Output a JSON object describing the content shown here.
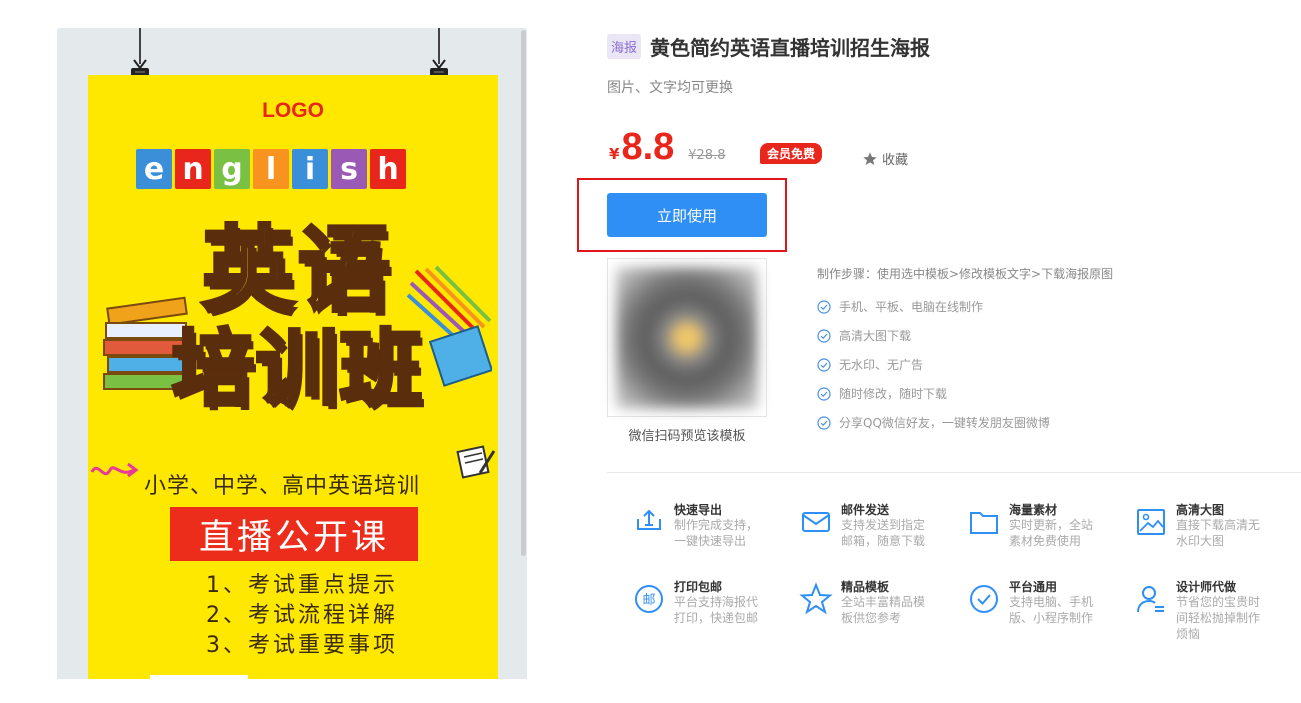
{
  "poster": {
    "logo": "LOGO",
    "english_letters": [
      "e",
      "n",
      "g",
      "l",
      "i",
      "s",
      "h"
    ],
    "letter_colors": [
      "#3b8fd9",
      "#e8261c",
      "#7ac143",
      "#f7931e",
      "#3b8fd9",
      "#9b59b6",
      "#e8261c"
    ],
    "title_line1": "英语",
    "title_line2": "培训班",
    "subtitle": "小学、中学、高中英语培训",
    "live_course": "直播公开课",
    "points": [
      "1、考试重点提示",
      "2、考试流程详解",
      "3、考试重要事项"
    ]
  },
  "detail": {
    "tag": "海报",
    "title": "黄色简约英语直播培训招生海报",
    "subtitle": "图片、文字均可更换",
    "currency": "¥",
    "price": "8.8",
    "original_price": "¥28.8",
    "vip_badge": "会员免费",
    "favorite_label": "收藏",
    "use_button": "立即使用",
    "qr_caption": "微信扫码预览该模板",
    "steps_heading": "制作步骤：使用选中模板>修改模板文字>下载海报原图",
    "features": [
      "手机、平板、电脑在线制作",
      "高清大图下载",
      "无水印、无广告",
      "随时修改，随时下载",
      "分享QQ微信好友，一键转发朋友圈微博"
    ]
  },
  "services": [
    {
      "name": "快速导出",
      "desc": "制作完成支持，一键快速导出",
      "icon": "export-icon"
    },
    {
      "name": "邮件发送",
      "desc": "支持发送到指定邮箱，随意下载",
      "icon": "mail-icon"
    },
    {
      "name": "海量素材",
      "desc": "实时更新，全站素材免费使用",
      "icon": "folder-icon"
    },
    {
      "name": "高清大图",
      "desc": "直接下载高清无水印大图",
      "icon": "image-icon"
    },
    {
      "name": "打印包邮",
      "desc": "平台支持海报代打印，快递包邮",
      "icon": "post-icon"
    },
    {
      "name": "精品模板",
      "desc": "全站丰富精品模板供您参考",
      "icon": "star-icon"
    },
    {
      "name": "平台通用",
      "desc": "支持电脑、手机版、小程序制作",
      "icon": "check-circle-icon"
    },
    {
      "name": "设计师代做",
      "desc": "节省您的宝贵时间轻松抛掉制作烦恼",
      "icon": "designer-icon"
    }
  ],
  "colors": {
    "accent": "#2f8ff5",
    "price_red": "#e8261c",
    "poster_yellow": "#ffe800",
    "highlight_border": "#e0161b"
  }
}
